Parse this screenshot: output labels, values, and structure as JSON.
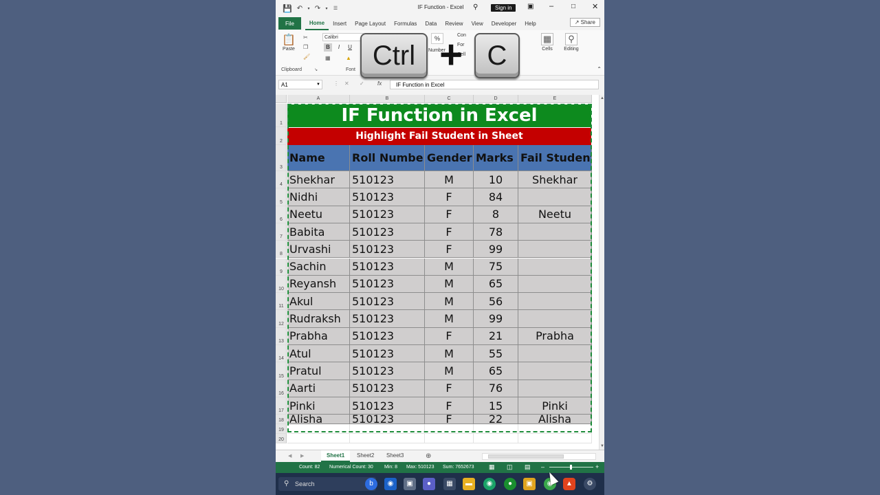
{
  "window": {
    "title": "IF Function  -  Excel",
    "sign_in": "Sign in"
  },
  "menu": {
    "tabs": [
      "File",
      "Home",
      "Insert",
      "Page Layout",
      "Formulas",
      "Data",
      "Review",
      "View",
      "Developer",
      "Help"
    ],
    "active": "Home",
    "share": "Share"
  },
  "ribbon": {
    "paste": "Paste",
    "clipboard": "Clipboard",
    "font_name": "Calibri",
    "bold": "B",
    "italic": "I",
    "underline": "U",
    "font_group": "Font",
    "number": "Number",
    "cf_items": [
      "Con",
      "For",
      "Cell"
    ],
    "cells": "Cells",
    "editing": "Editing"
  },
  "keys": {
    "ctrl": "Ctrl",
    "plus": "+",
    "c": "C"
  },
  "formula_bar": {
    "name_box": "A1",
    "fx": "fx",
    "formula": "IF Function in Excel"
  },
  "sheet": {
    "columns": [
      "A",
      "B",
      "C",
      "D",
      "E"
    ],
    "rows": [
      "1",
      "2",
      "3",
      "4",
      "5",
      "6",
      "7",
      "8",
      "9",
      "10",
      "11",
      "12",
      "13",
      "14",
      "15",
      "16",
      "17",
      "18",
      "19",
      "20"
    ],
    "title": "IF Function in Excel",
    "subtitle": "Highlight Fail Student in Sheet",
    "headers": [
      "Name",
      "Roll Number",
      "Gender",
      "Marks",
      "Fail Students"
    ],
    "data": [
      [
        "Shekhar",
        "510123",
        "M",
        "10",
        "Shekhar"
      ],
      [
        "Nidhi",
        "510123",
        "F",
        "84",
        ""
      ],
      [
        "Neetu",
        "510123",
        "F",
        "8",
        "Neetu"
      ],
      [
        "Babita",
        "510123",
        "F",
        "78",
        ""
      ],
      [
        "Urvashi",
        "510123",
        "F",
        "99",
        ""
      ],
      [
        "Sachin",
        "510123",
        "M",
        "75",
        ""
      ],
      [
        "Reyansh",
        "510123",
        "M",
        "65",
        ""
      ],
      [
        "Akul",
        "510123",
        "M",
        "56",
        ""
      ],
      [
        "Rudraksh",
        "510123",
        "M",
        "99",
        ""
      ],
      [
        "Prabha",
        "510123",
        "F",
        "21",
        "Prabha"
      ],
      [
        "Atul",
        "510123",
        "M",
        "55",
        ""
      ],
      [
        "Pratul",
        "510123",
        "M",
        "65",
        ""
      ],
      [
        "Aarti",
        "510123",
        "F",
        "76",
        ""
      ],
      [
        "Pinki",
        "510123",
        "F",
        "15",
        "Pinki"
      ],
      [
        "Alisha",
        "510123",
        "F",
        "22",
        "Alisha"
      ]
    ]
  },
  "sheet_tabs": [
    "Sheet1",
    "Sheet2",
    "Sheet3"
  ],
  "active_sheet": "Sheet1",
  "status": {
    "count": "Count: 82",
    "numerical_count": "Numerical Count: 30",
    "min": "Min: 8",
    "max": "Max: 510123",
    "sum": "Sum: 7652673"
  },
  "taskbar": {
    "search": "Search"
  },
  "colors": {
    "excel_green": "#217346",
    "title_band": "#0d8a1e",
    "subtitle_band": "#c40000",
    "header_fill": "#4a74b1",
    "data_fill": "#d0cece"
  }
}
